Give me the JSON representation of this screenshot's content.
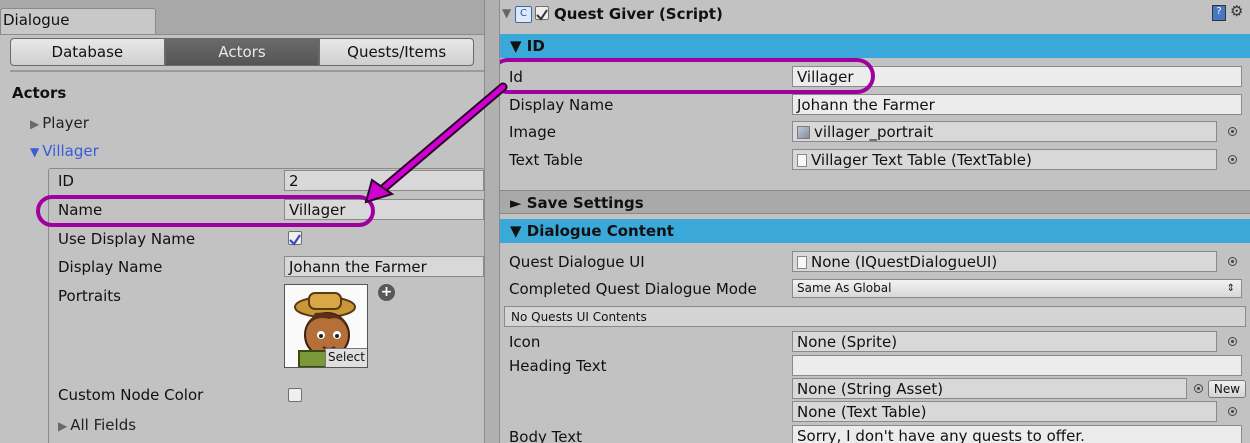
{
  "window_tab": "Dialogue",
  "toolbar": [
    "Database",
    "Actors",
    "Quests/Items"
  ],
  "actors": {
    "heading": "Actors",
    "items": [
      {
        "label": "Player"
      },
      {
        "label": "Villager"
      }
    ],
    "fields": {
      "id_label": "ID",
      "id_value": "2",
      "name_label": "Name",
      "name_value": "Villager",
      "use_display_name_label": "Use Display Name",
      "display_name_label": "Display Name",
      "display_name_value": "Johann the Farmer",
      "portraits_label": "Portraits",
      "select_label": "Select",
      "add_symbol": "+",
      "custom_node_color_label": "Custom Node Color",
      "all_fields_label": "All Fields"
    }
  },
  "component": {
    "title": "Quest Giver (Script)",
    "id_section": "▼ ID",
    "id_rows": [
      {
        "label": "Id",
        "value": "Villager"
      },
      {
        "label": "Display Name",
        "value": "Johann the Farmer"
      },
      {
        "label": "Image",
        "value": "villager_portrait"
      },
      {
        "label": "Text Table",
        "value": "Villager Text Table (TextTable)"
      }
    ],
    "save_section": "► Save Settings",
    "dialogue_section": "▼ Dialogue Content",
    "dialogue_rows": {
      "quest_ui_label": "Quest Dialogue UI",
      "quest_ui_value": "None (IQuestDialogueUI)",
      "completed_mode_label": "Completed Quest Dialogue Mode",
      "completed_mode_value": "Same As Global",
      "no_quests_header": "No Quests UI Contents",
      "icon_label": "Icon",
      "icon_value": "None (Sprite)",
      "heading_text_label": "Heading Text",
      "heading_text_value": "",
      "string_asset_value": "None (String Asset)",
      "new_button": "New",
      "text_table_value": "None (Text Table)",
      "body_text_label": "Body Text",
      "body_text_value": "Sorry, I don't have any quests to offer."
    }
  },
  "colors": {
    "accent_section": "#3aa8d8",
    "highlight": "#a000a0",
    "toggle_blue": "#3a5cd8"
  }
}
